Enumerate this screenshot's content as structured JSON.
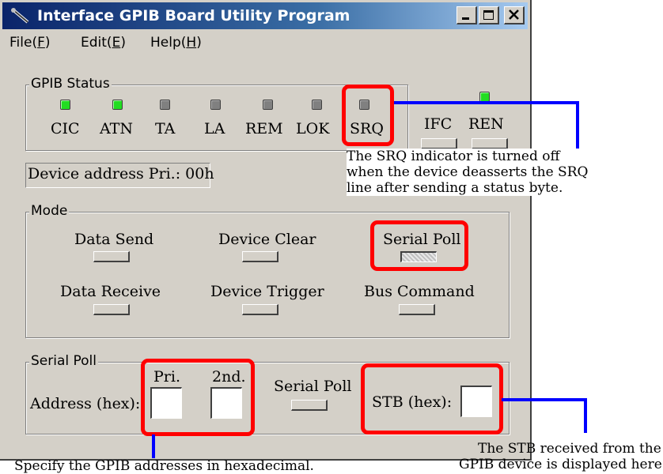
{
  "window": {
    "title": "Interface GPIB Board Utility Program",
    "title_icon": "probe-icon",
    "controls": [
      "minimize",
      "maximize",
      "close"
    ]
  },
  "menu": {
    "file": {
      "label": "File(",
      "key": "F",
      "end": ")"
    },
    "edit": {
      "label": "Edit(",
      "key": "E",
      "end": ")"
    },
    "help": {
      "label": "Help(",
      "key": "H",
      "end": ")"
    }
  },
  "gpib_status": {
    "title": "GPIB Status",
    "indicators": [
      {
        "label": "CIC",
        "on": true
      },
      {
        "label": "ATN",
        "on": true
      },
      {
        "label": "TA",
        "on": false
      },
      {
        "label": "LA",
        "on": false
      },
      {
        "label": "REM",
        "on": false
      },
      {
        "label": "LOK",
        "on": false
      },
      {
        "label": "SRQ",
        "on": false
      }
    ]
  },
  "lines": {
    "ifc": {
      "label": "IFC"
    },
    "ren": {
      "label": "REN",
      "led_on": true
    }
  },
  "device_address": "Device address Pri.: 00h",
  "mode": {
    "title": "Mode",
    "data_send": "Data Send",
    "device_clear": "Device Clear",
    "serial_poll": "Serial Poll",
    "data_receive": "Data Receive",
    "device_trigger": "Device Trigger",
    "bus_command": "Bus Command"
  },
  "serial_poll_group": {
    "title": "Serial Poll",
    "address_label": "Address (hex):",
    "pri_label": "Pri.",
    "second_label": "2nd.",
    "pri_value": "",
    "second_value": "",
    "button_label": "Serial Poll",
    "stb_label": "STB (hex):",
    "stb_value": ""
  },
  "annotations": {
    "srq_note": [
      "The SRQ indicator is turned off",
      "when the device deasserts the SRQ",
      "line after sending a status byte."
    ],
    "stb_note": [
      "The STB received from the",
      "GPIB device is displayed here."
    ],
    "address_note": "Specify the GPIB addresses in hexadecimal."
  },
  "colors": {
    "highlight": "#ff0000",
    "leader_line": "#0000ff",
    "led_on": "#22dd22",
    "led_off": "#808080",
    "window_face": "#d4d0c8",
    "title_gradient_start": "#0a246a"
  }
}
